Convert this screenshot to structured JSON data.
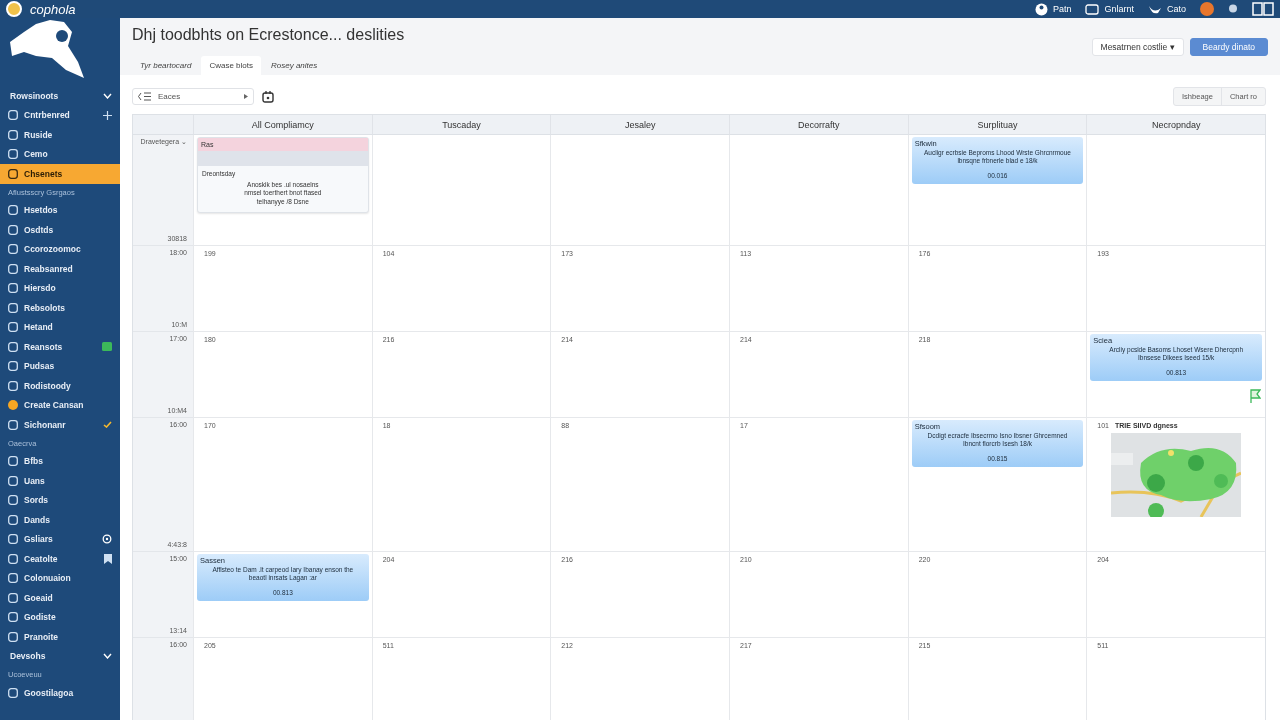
{
  "app": {
    "name": "cophola"
  },
  "top_bar": {
    "items": [
      {
        "label": "Patn"
      },
      {
        "label": "Gnlarnt"
      },
      {
        "label": "Cato"
      }
    ]
  },
  "sidebar": {
    "items": [
      {
        "kind": "group",
        "label": "Rowsinoots",
        "expanded": true,
        "selected": false
      },
      {
        "kind": "addable",
        "label": "Cntrbenred",
        "selected": false
      },
      {
        "kind": "item",
        "label": "Ruside",
        "selected": false
      },
      {
        "kind": "item",
        "label": "Cemo",
        "selected": false
      },
      {
        "kind": "item",
        "label": "Chsenets",
        "selected": true
      },
      {
        "kind": "section",
        "label": "Aflustsscry Gsrgaos"
      },
      {
        "kind": "item",
        "label": "Hsetdos",
        "selected": false
      },
      {
        "kind": "item",
        "label": "Osdtds",
        "selected": false
      },
      {
        "kind": "item",
        "label": "Ccorozoomoc",
        "selected": false
      },
      {
        "kind": "item",
        "label": "Reabsanred",
        "selected": false
      },
      {
        "kind": "item",
        "label": "Hiersdo",
        "selected": false
      },
      {
        "kind": "item",
        "label": "Rebsolots",
        "selected": false
      },
      {
        "kind": "item",
        "label": "Hetand",
        "selected": false
      },
      {
        "kind": "counted",
        "label": "Reansots",
        "selected": false
      },
      {
        "kind": "item",
        "label": "Pudsas",
        "selected": false
      },
      {
        "kind": "item",
        "label": "Rodistoody",
        "selected": false
      },
      {
        "kind": "status",
        "label": "Create Cansan",
        "selected": false
      },
      {
        "kind": "done",
        "label": "Sichonanr",
        "selected": false
      },
      {
        "kind": "section",
        "label": "Oaecrva"
      },
      {
        "kind": "item",
        "label": "Bfbs",
        "selected": false
      },
      {
        "kind": "item",
        "label": "Uans",
        "selected": false
      },
      {
        "kind": "item",
        "label": "Sords",
        "selected": false
      },
      {
        "kind": "item",
        "label": "Dands",
        "selected": false
      },
      {
        "kind": "settings",
        "label": "Gsliars",
        "selected": false
      },
      {
        "kind": "saved",
        "label": "Ceatolte",
        "selected": false
      },
      {
        "kind": "item",
        "label": "Colonuaion",
        "selected": false
      },
      {
        "kind": "item",
        "label": "Goeaid",
        "selected": false
      },
      {
        "kind": "item",
        "label": "Godiste",
        "selected": false
      },
      {
        "kind": "item",
        "label": "Pranoite",
        "selected": false
      },
      {
        "kind": "group",
        "label": "Devsohs",
        "expanded": true,
        "selected": false
      },
      {
        "kind": "section",
        "label": "Ucoeveuu"
      },
      {
        "kind": "item",
        "label": "Goostilagoa",
        "selected": false
      }
    ]
  },
  "page": {
    "title": "Dhj toodbhts on Ecrestonce... deslities",
    "tabs": [
      {
        "label": "Tyr beartocard",
        "selected": false
      },
      {
        "label": "Cwase blots",
        "selected": true
      },
      {
        "label": "Rosey anites",
        "selected": false
      }
    ],
    "buttons": [
      {
        "label": "Mesatrnen costlie ▾",
        "kind": "secondary"
      },
      {
        "label": "Beardy dinato",
        "kind": "primary"
      }
    ]
  },
  "toolbar": {
    "select": {
      "value": "Eaces"
    },
    "view_toggle": [
      {
        "label": "Ishbeage",
        "selected": false
      },
      {
        "label": "Chart ro",
        "selected": false
      }
    ]
  },
  "calendar": {
    "columns": [
      "All Compliamcy",
      "Tuscaday",
      "Jesaley",
      "Decorrafty",
      "Surplituay",
      "Necropnday"
    ],
    "rows": [
      {
        "time": "Dravetegera ⌄",
        "time_end": "30818",
        "cells": [
          {
            "event": {
              "kind": "card",
              "header": "Ras",
              "label": "Dreontsday",
              "text": "Anoskik bes .ul nosaelns nmsel toerthert bnot ftased telhanyye /8 Dsne"
            }
          },
          {},
          {},
          {},
          {
            "event": {
              "kind": "blue",
              "header": "Sfkwin",
              "text": "Aucligr ecrbsie Beproms Lhood Wrste Ghrcnrmoue lbnsqne frbnerle blad e 18/k",
              "time": "00.016"
            }
          },
          {}
        ]
      },
      {
        "time": "18:00",
        "time_end": "10:M",
        "cells": [
          {
            "date": "199"
          },
          {
            "date": "104"
          },
          {
            "date": "173"
          },
          {
            "date": "113"
          },
          {
            "date": "176"
          },
          {
            "date": "193"
          }
        ]
      },
      {
        "time": "17:00",
        "time_end": "10:M4",
        "cells": [
          {
            "date": "180"
          },
          {
            "date": "216"
          },
          {
            "date": "214"
          },
          {
            "date": "214"
          },
          {
            "date": "218"
          },
          {
            "event": {
              "kind": "blue",
              "header": "Sciea",
              "text": "Arcliy pcslde Basoms Lhoset Wsere Dhercpnh Ibnsese Dlkees Iseed 15/k",
              "time": "00.813"
            },
            "flag": true
          }
        ]
      },
      {
        "time": "16:00",
        "time_end": "4:43:8",
        "cells": [
          {
            "date": "170"
          },
          {
            "date": "18"
          },
          {
            "date": "88"
          },
          {
            "date": "17"
          },
          {
            "event": {
              "kind": "blue",
              "header": "Sfsoom",
              "text": "Dcdigt ecracfe Ibsecrmo Isno Ibsner Ghrcemned Ibncnt florcrb Isesh 18/k",
              "time": "00.815"
            }
          },
          {
            "date": "101",
            "map": {
              "kind": "picture",
              "title": "TRIE SIIVD dgness"
            }
          }
        ]
      },
      {
        "time": "15:00",
        "time_end": "13:14",
        "cells": [
          {
            "event": {
              "kind": "blue",
              "header": "Sassen",
              "text": "Afflsteo te Dam .lt carpeod Iary Ibanay enson the beaotl inrsats Lagan :ar",
              "time": "00.813"
            }
          },
          {
            "date": "204"
          },
          {
            "date": "216"
          },
          {
            "date": "210"
          },
          {
            "date": "220"
          },
          {
            "date": "204"
          }
        ]
      },
      {
        "time": "16:00",
        "cells": [
          {
            "date": "205"
          },
          {
            "date": "511"
          },
          {
            "date": "212"
          },
          {
            "date": "217"
          },
          {
            "date": "215"
          },
          {
            "date": "511"
          }
        ]
      }
    ]
  }
}
